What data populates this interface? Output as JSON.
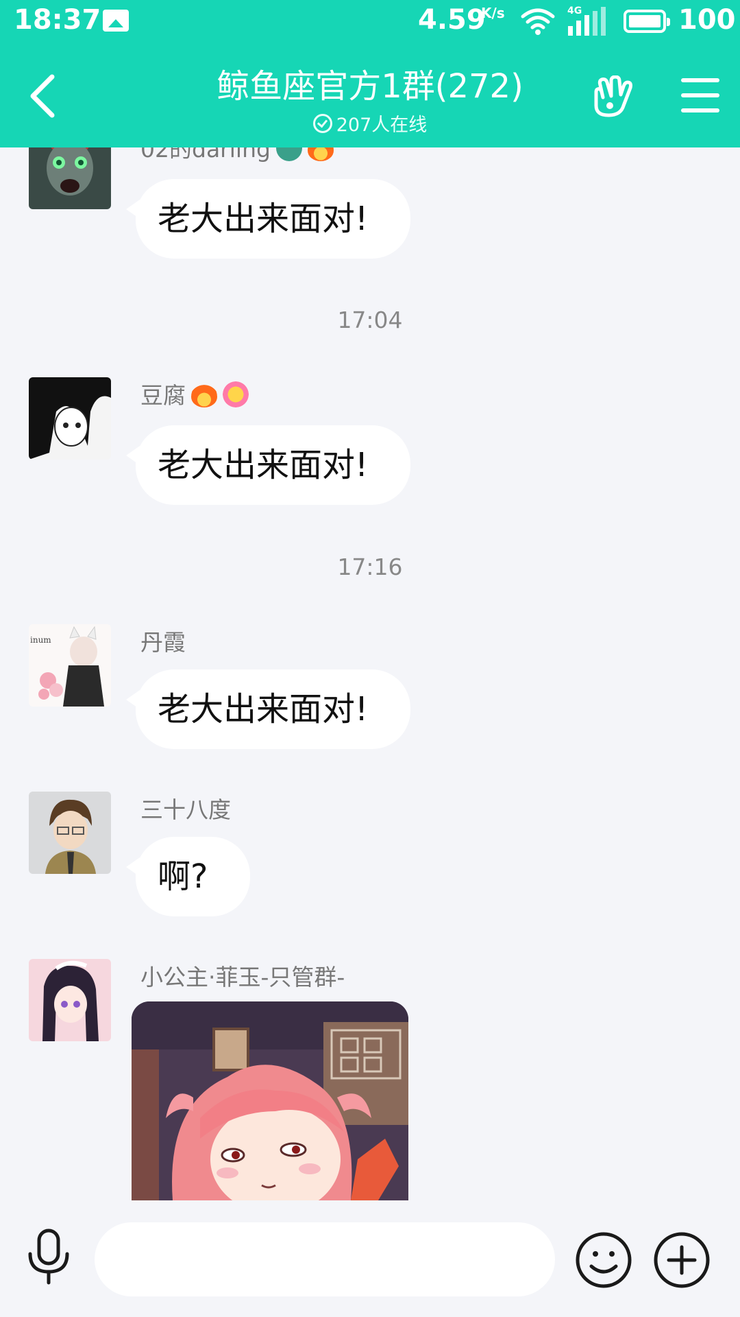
{
  "status_bar": {
    "time": "18:37",
    "net_speed": "4.59",
    "net_speed_unit": "K/s",
    "network_type": "4G",
    "battery": "100"
  },
  "header": {
    "title": "鲸鱼座官方1群(272)",
    "subtitle": "207人在线",
    "icons": [
      "back-icon",
      "hand-gesture-icon",
      "menu-icon"
    ]
  },
  "messages": [
    {
      "type": "text",
      "sender": "02的darling",
      "text": "老大出来面对!"
    },
    {
      "type": "timestamp",
      "text": "17:04"
    },
    {
      "type": "text",
      "sender": "豆腐",
      "text": "老大出来面对!"
    },
    {
      "type": "timestamp",
      "text": "17:16"
    },
    {
      "type": "text",
      "sender": "丹霞",
      "avatar_text": "inum",
      "text": "老大出来面对!"
    },
    {
      "type": "text",
      "sender": "三十八度",
      "text": "啊?"
    },
    {
      "type": "sticker",
      "sender": "小公主·菲玉-只管群-"
    }
  ],
  "input": {
    "value": "",
    "placeholder": ""
  },
  "colors": {
    "accent": "#16d6b5",
    "background": "#f4f5f9",
    "bubble": "#ffffff"
  }
}
